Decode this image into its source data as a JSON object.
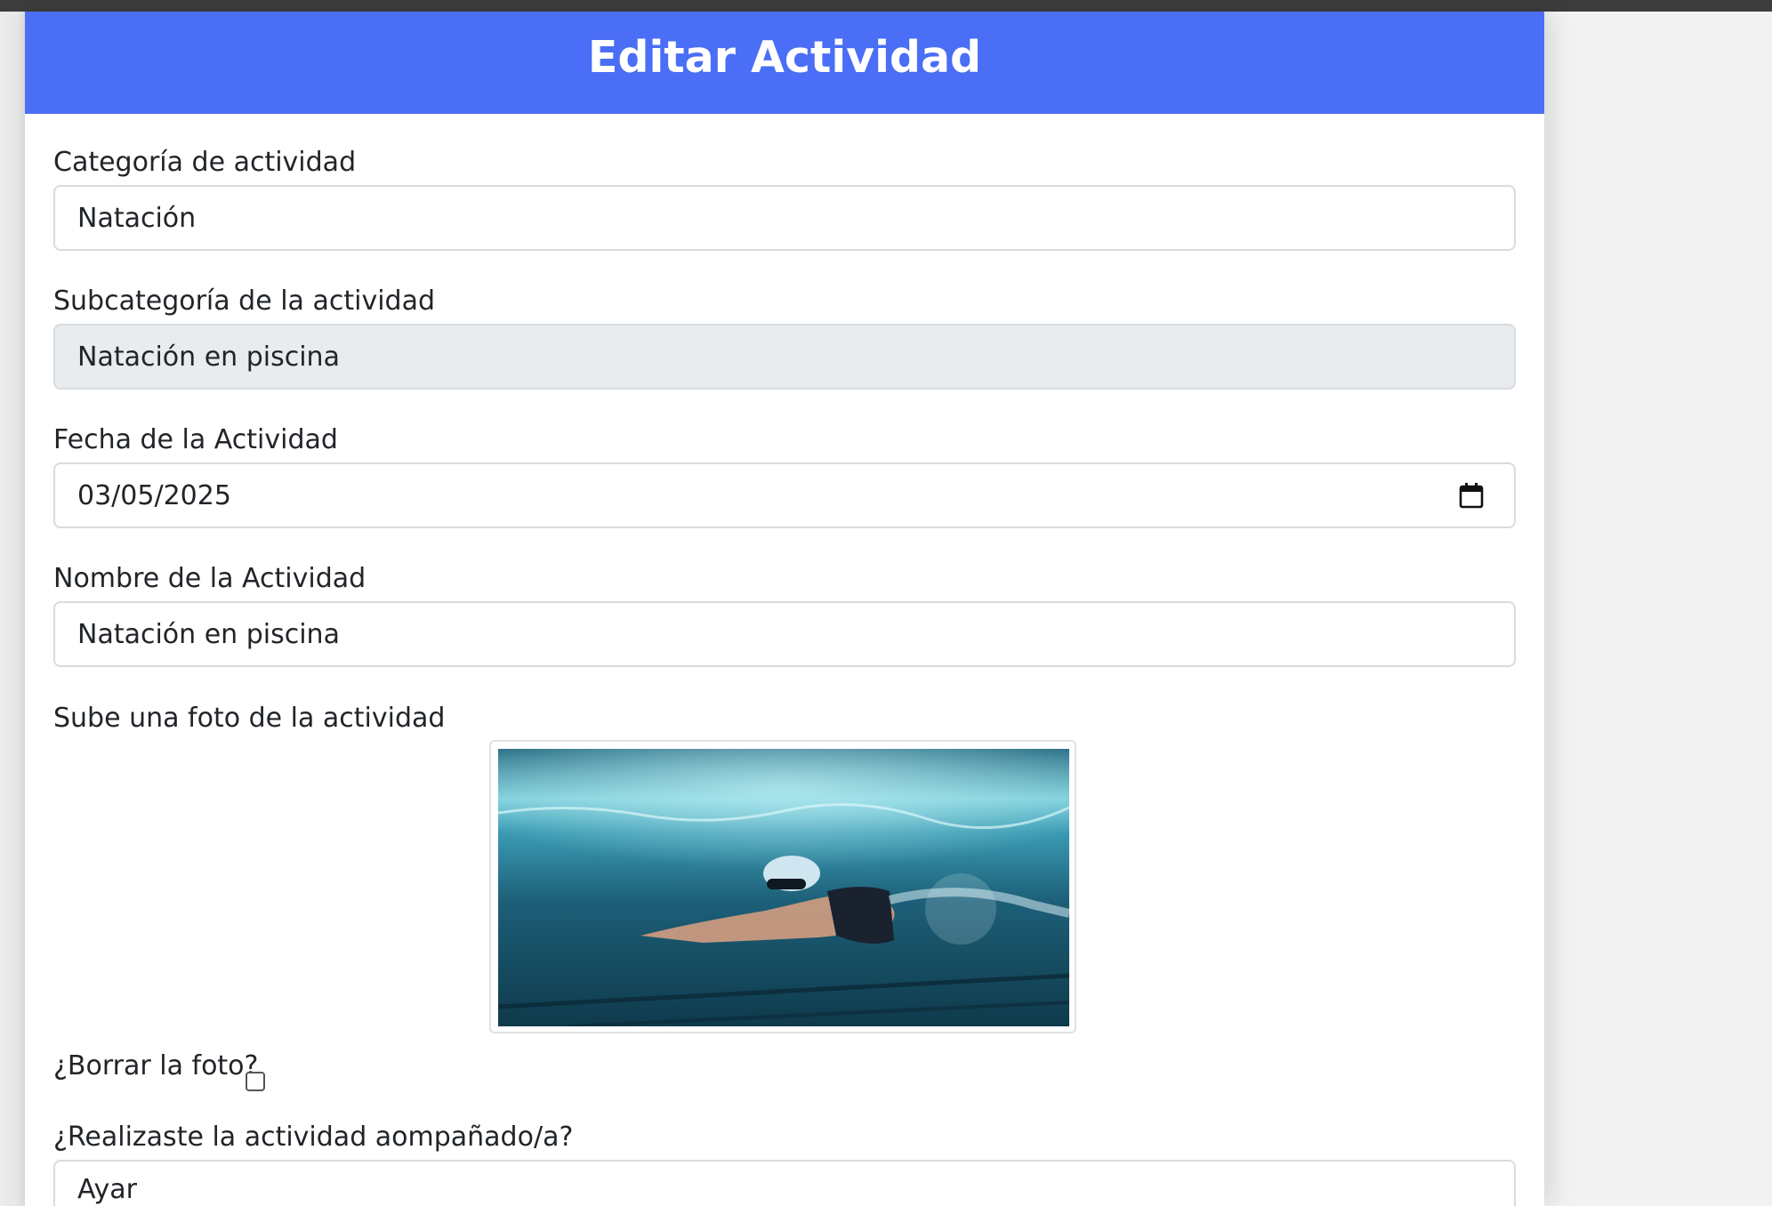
{
  "header": {
    "title": "Editar Actividad"
  },
  "form": {
    "category": {
      "label": "Categoría de actividad",
      "value": "Natación"
    },
    "subcategory": {
      "label": "Subcategoría de la actividad",
      "value": "Natación en piscina"
    },
    "date": {
      "label": "Fecha de la Actividad",
      "value": "03/05/2025",
      "icon": "calendar-icon"
    },
    "name": {
      "label": "Nombre de la Actividad",
      "value": "Natación en piscina"
    },
    "photo": {
      "label": "Sube una foto de la actividad"
    },
    "delete_photo": {
      "label": "¿Borrar la foto?",
      "checked": false
    },
    "accompanied": {
      "label": "¿Realizaste la actividad aompañado/a?",
      "value": "Ayar"
    }
  },
  "colors": {
    "header_bg": "#4a6ef5",
    "readonly_bg": "#e9ecef",
    "border": "#d8dbe0"
  }
}
